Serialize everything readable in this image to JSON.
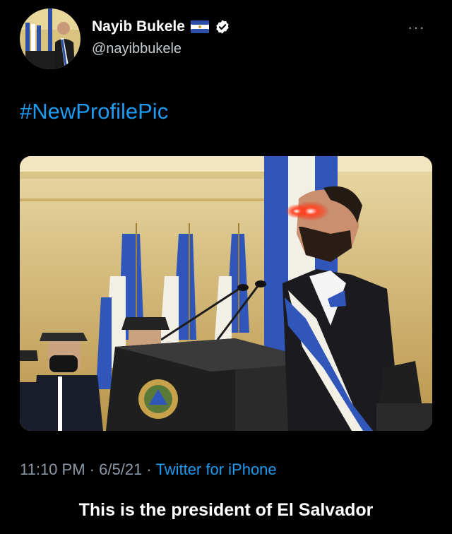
{
  "tweet": {
    "author_name": "Nayib Bukele",
    "handle": "@nayibbukele",
    "hashtag": "#NewProfilePic",
    "time": "11:10 PM",
    "date": "6/5/21",
    "separator": "·",
    "source": "Twitter for iPhone",
    "icons": {
      "flag": "el-salvador-flag-icon",
      "verified": "verified-badge-icon",
      "more": "more-options-icon"
    }
  },
  "caption": "This is the president of El Salvador",
  "colors": {
    "background": "#000000",
    "link": "#1d9bf0",
    "secondary_text": "#8b98a5",
    "flag_blue": "#2c50a8"
  }
}
